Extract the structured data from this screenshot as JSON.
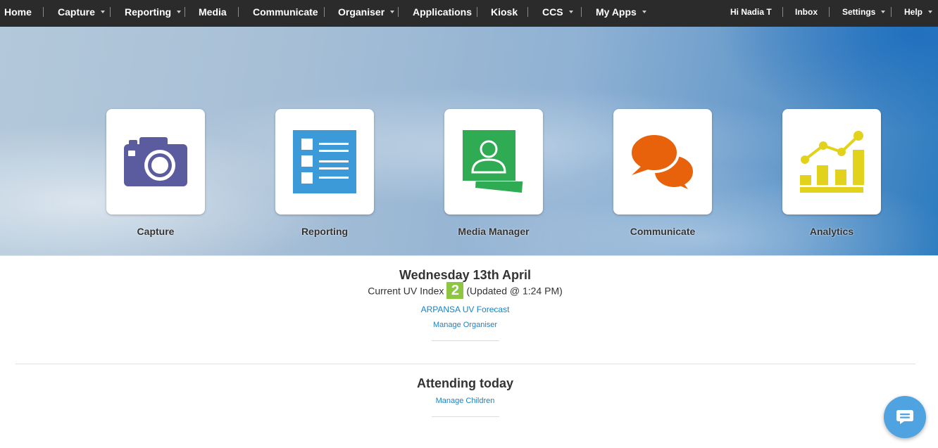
{
  "nav": {
    "home": "Home",
    "capture": "Capture",
    "reporting": "Reporting",
    "media": "Media",
    "communicate": "Communicate",
    "organiser": "Organiser",
    "applications": "Applications",
    "kiosk": "Kiosk",
    "ccs": "CCS",
    "my_apps": "My Apps",
    "greeting": "Hi Nadia T",
    "inbox": "Inbox",
    "settings": "Settings",
    "help": "Help"
  },
  "tiles": [
    {
      "label": "Capture",
      "icon": "camera-icon",
      "color": "#5b5ba0"
    },
    {
      "label": "Reporting",
      "icon": "report-list-icon",
      "color": "#3d9ad8"
    },
    {
      "label": "Media Manager",
      "icon": "media-profile-icon",
      "color": "#2fab53"
    },
    {
      "label": "Communicate",
      "icon": "chat-bubbles-icon",
      "color": "#e8620c"
    },
    {
      "label": "Analytics",
      "icon": "analytics-chart-icon",
      "color": "#e3d21c"
    }
  ],
  "day": {
    "date": "Wednesday 13th April",
    "uv_prefix": "Current UV Index",
    "uv_value": "2",
    "uv_color": "#8dc63f",
    "uv_updated": "(Updated @ 1:24 PM)",
    "forecast_link": "ARPANSA UV Forecast",
    "manage_organiser": "Manage Organiser"
  },
  "attending": {
    "title": "Attending today",
    "manage_children": "Manage Children"
  },
  "chat_button": {
    "icon": "chat-icon",
    "color": "#4fa3e0"
  }
}
